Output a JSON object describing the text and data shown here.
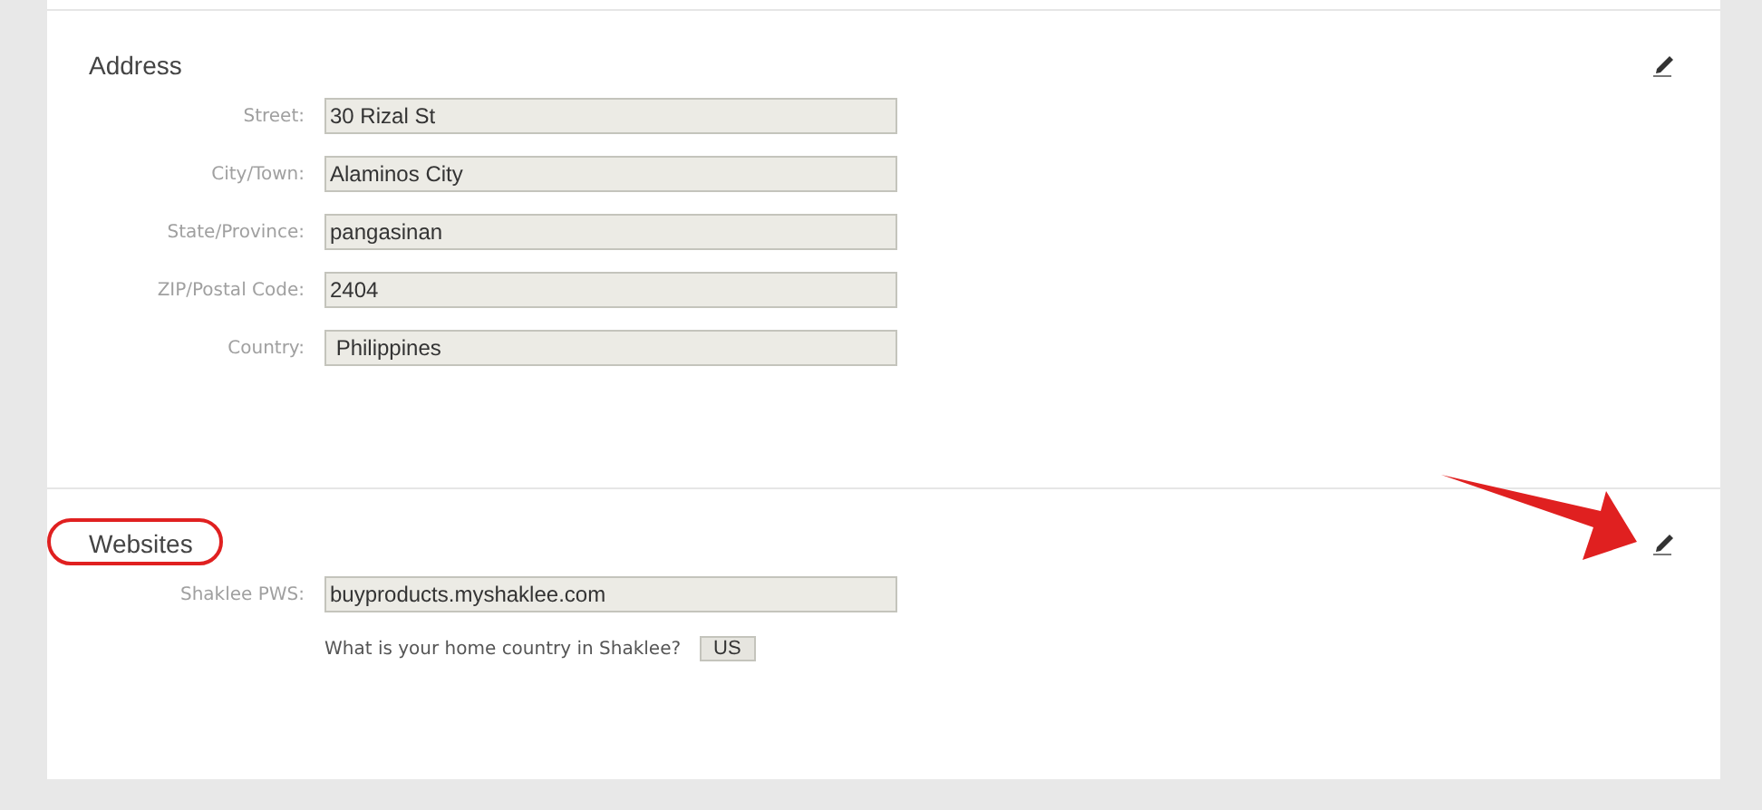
{
  "sections": [
    {
      "title": "Address",
      "highlighted": false,
      "pointer_arrow": false,
      "fields": [
        {
          "label": "Street:",
          "value": "30 Rizal St"
        },
        {
          "label": "City/Town:",
          "value": "Alaminos City"
        },
        {
          "label": "State/Province:",
          "value": "pangasinan"
        },
        {
          "label": "ZIP/Postal Code:",
          "value": "2404"
        },
        {
          "label": "Country:",
          "value": " Philippines"
        }
      ]
    },
    {
      "title": "Websites",
      "highlighted": true,
      "pointer_arrow": true,
      "fields": [
        {
          "label": "Shaklee PWS:",
          "value": "buyproducts.myshaklee.com"
        }
      ],
      "question": {
        "text": "What is your home country in Shaklee?",
        "answer": "US"
      }
    }
  ]
}
